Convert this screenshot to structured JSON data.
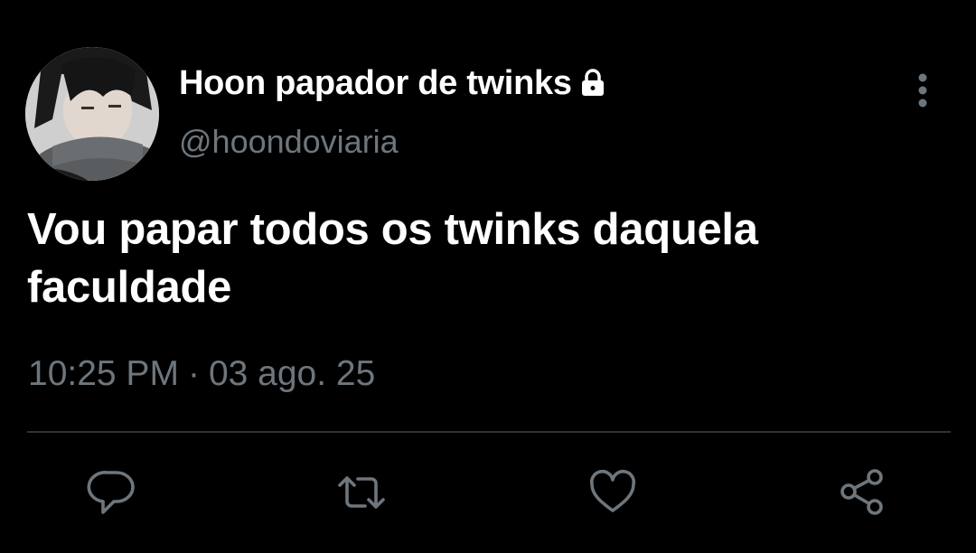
{
  "user": {
    "display_name": "Hoon papador de twinks",
    "handle": "@hoondoviaria",
    "protected": true
  },
  "tweet": {
    "text": "Vou papar todos os twinks daquela faculdade",
    "time": "10:25 PM",
    "separator": "·",
    "date": "03 ago. 25"
  },
  "icons": {
    "lock": "lock-icon",
    "more": "more-vertical-icon",
    "reply": "reply-icon",
    "retweet": "retweet-icon",
    "like": "heart-icon",
    "share": "share-icon"
  },
  "colors": {
    "background": "#000000",
    "primary_text": "#ffffff",
    "secondary_text": "#6e767d",
    "divider": "#2f3336"
  }
}
